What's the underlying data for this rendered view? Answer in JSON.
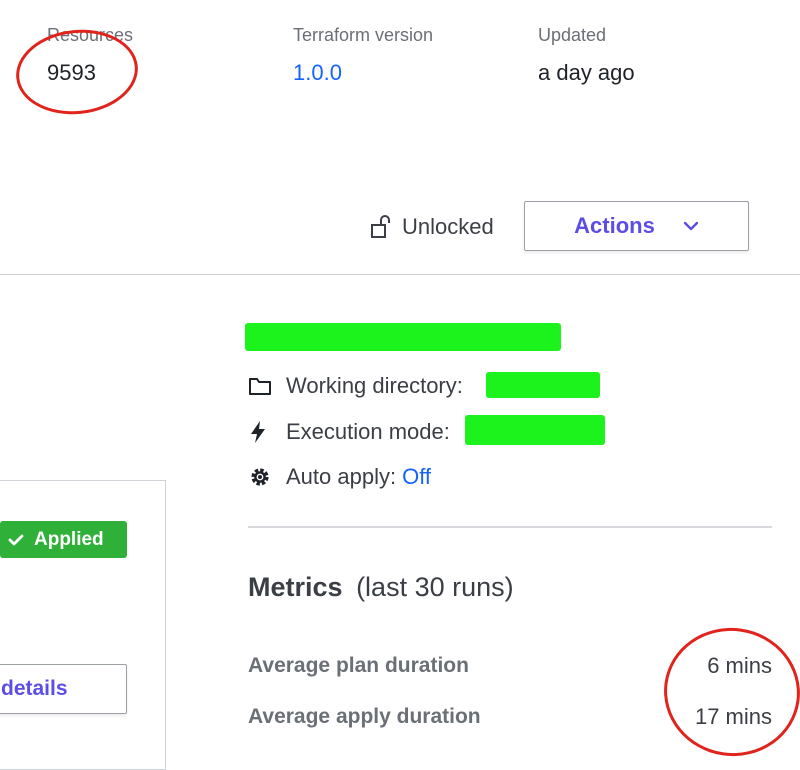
{
  "stats": {
    "resources": {
      "label": "Resources",
      "value": "9593"
    },
    "terraform": {
      "label": "Terraform version",
      "value": "1.0.0"
    },
    "updated": {
      "label": "Updated",
      "value": "a day ago"
    }
  },
  "toolbar": {
    "lock_status": "Unlocked",
    "actions_label": "Actions"
  },
  "run_card": {
    "status_badge": "Applied",
    "details_label": "details"
  },
  "workspace": {
    "working_directory_label": "Working directory:",
    "execution_mode_label": "Execution mode:",
    "auto_apply_label": "Auto apply:",
    "auto_apply_value": "Off"
  },
  "metrics": {
    "title": "Metrics",
    "subtitle": "(last 30 runs)",
    "rows": [
      {
        "label": "Average plan duration",
        "value": "6 mins"
      },
      {
        "label": "Average apply duration",
        "value": "17 mins"
      }
    ]
  },
  "colors": {
    "link": "#1563ff",
    "accent": "#5c4ee5",
    "success": "#2eb039",
    "annotation": "#e0231c",
    "redaction": "#1cf21c"
  }
}
